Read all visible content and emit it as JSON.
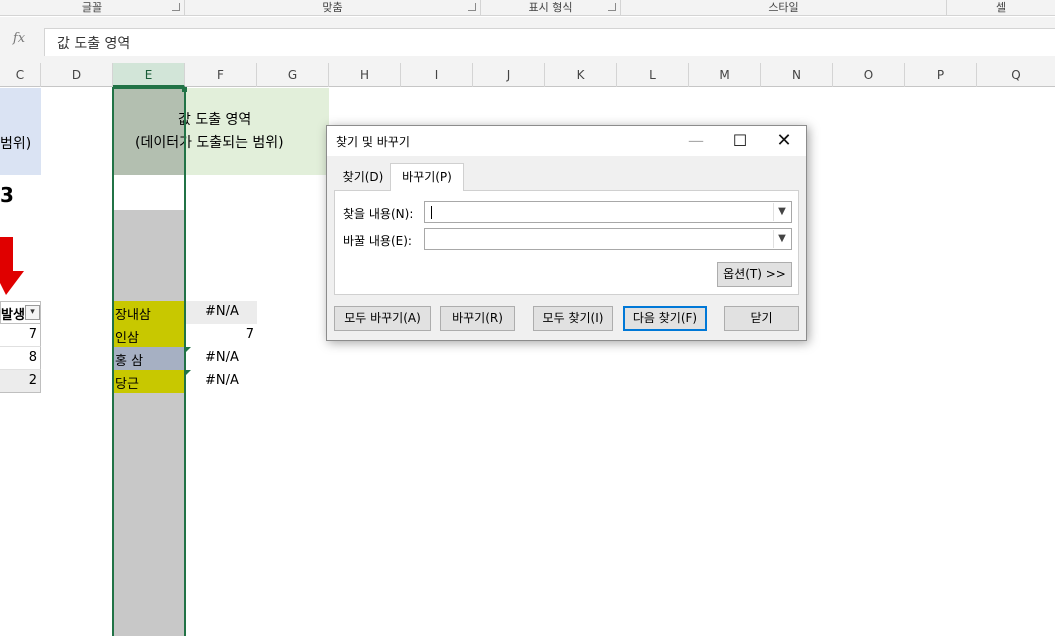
{
  "ribbon": {
    "groups": [
      "글꼴",
      "맞춤",
      "표시 형식",
      "스타일",
      "셀"
    ]
  },
  "formula_bar": {
    "fx_label": "fx",
    "value": "값 도출 영역"
  },
  "columns": [
    "C",
    "D",
    "E",
    "F",
    "G",
    "H",
    "I",
    "J",
    "K",
    "L",
    "M",
    "N",
    "O",
    "P",
    "Q"
  ],
  "selected_column": "E",
  "sheet": {
    "left_header_fragment": "범위)",
    "big_number": "3",
    "filter_header_fragment": "발생",
    "c_values": [
      "7",
      "8",
      "2"
    ],
    "value_area_title": "값 도출 영역",
    "value_area_subtitle": "(데이터가 도출되는 범위)",
    "e_items": [
      "장내삼",
      "인삼",
      "홍 삼",
      "당근"
    ],
    "f_values": [
      "#N/A",
      "7",
      "#N/A",
      "#N/A"
    ]
  },
  "dialog": {
    "title": "찾기 및 바꾸기",
    "tabs": [
      "찾기(D)",
      "바꾸기(P)"
    ],
    "active_tab": "바꾸기(P)",
    "find_label": "찾을 내용(N):",
    "find_value": "",
    "replace_label": "바꿀 내용(E):",
    "replace_value": "",
    "options_button": "옵션(T) >>",
    "buttons": {
      "replace_all": "모두 바꾸기(A)",
      "replace": "바꾸기(R)",
      "find_all": "모두 찾기(I)",
      "find_next": "다음 찾기(F)",
      "close": "닫기"
    }
  },
  "colors": {
    "accent_green": "#217346",
    "yellow_cell": "#c8c800",
    "blue_gray_cell": "#a6b0c3",
    "light_green_fill": "#e2efda",
    "light_blue_fill": "#dae3f3",
    "column_gray": "#c8c8c8",
    "arrow_red": "#e00000",
    "dialog_focus_blue": "#0078d7"
  }
}
